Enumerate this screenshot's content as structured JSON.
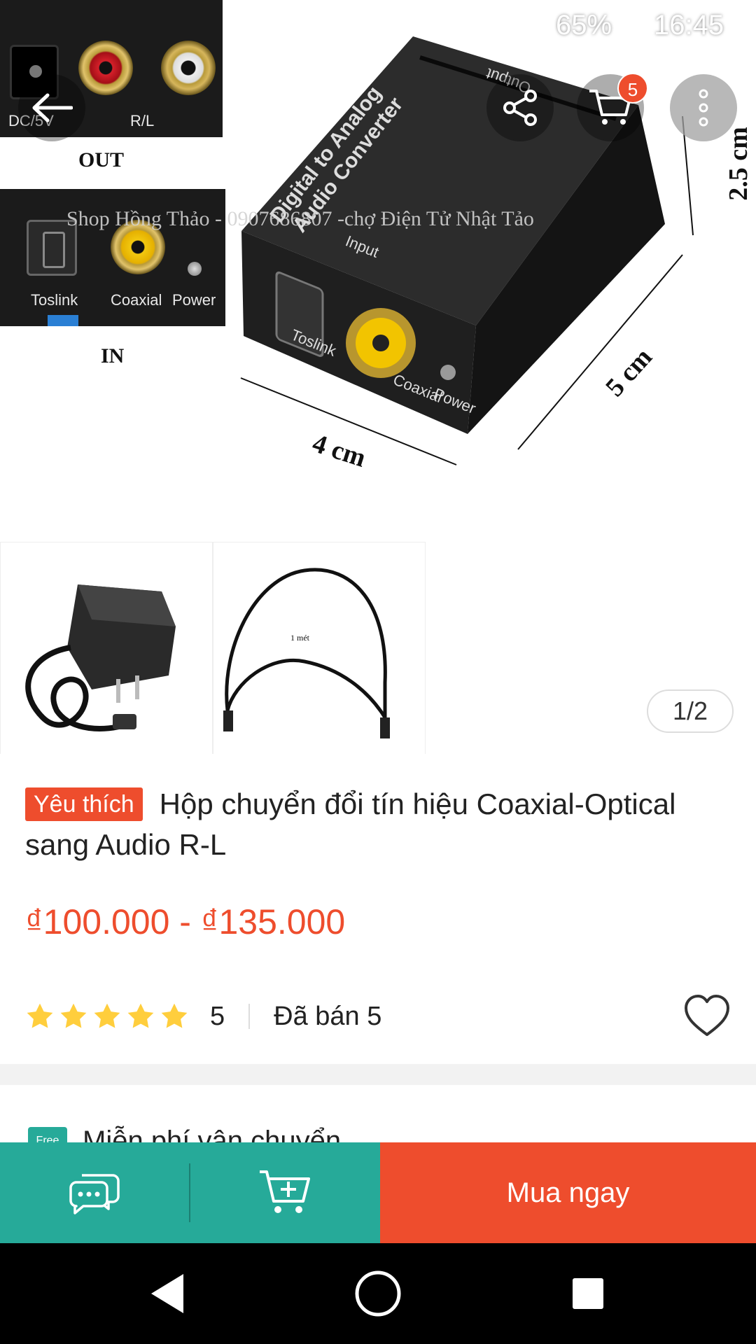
{
  "status_bar": {
    "battery": "65%",
    "time": "16:45"
  },
  "toolbar": {
    "cart_count": "5"
  },
  "hero_image": {
    "panel_out": {
      "labels": [
        "DC/5V",
        "R/L"
      ],
      "caption": "OUT"
    },
    "panel_in": {
      "labels": [
        "Toslink",
        "Coaxial",
        "Power"
      ],
      "caption": "IN"
    },
    "device": {
      "top_text_line1": "Digital to Analog",
      "top_text_line2": "Audio Converter",
      "input_label": "Input",
      "output_label": "Output",
      "port_labels": [
        "Toslink",
        "Coaxial",
        "Power"
      ]
    },
    "watermark": "Shop Hồng Thảo - 0907686807 -chợ Điện Tử Nhật Tảo",
    "dimensions": {
      "width": "4 cm",
      "depth": "5 cm",
      "height": "2.5 cm"
    }
  },
  "thumbnails": {
    "cable_label": "1 mét"
  },
  "gallery": {
    "page_indicator": "1/2"
  },
  "product": {
    "tag": "Yêu thích",
    "title": "Hộp chuyển đổi tín hiệu Coaxial-Optical sang Audio R-L",
    "price": "₫100.000 - ₫135.000",
    "rating": "5",
    "sold": "Đã bán 5",
    "stars": 5
  },
  "shipping": {
    "badge": "Free",
    "text": "Miễn phí vận chuyển"
  },
  "action_bar": {
    "buy_now": "Mua ngay"
  },
  "colors": {
    "accent": "#ee4d2d",
    "teal": "#26aa99",
    "star": "#ffce3d"
  },
  "icons": {
    "back": "arrow-left-icon",
    "share": "share-icon",
    "cart": "cart-icon",
    "more": "more-vertical-icon",
    "heart": "heart-outline-icon",
    "chat": "chat-icon",
    "add_to_cart": "cart-plus-icon"
  }
}
